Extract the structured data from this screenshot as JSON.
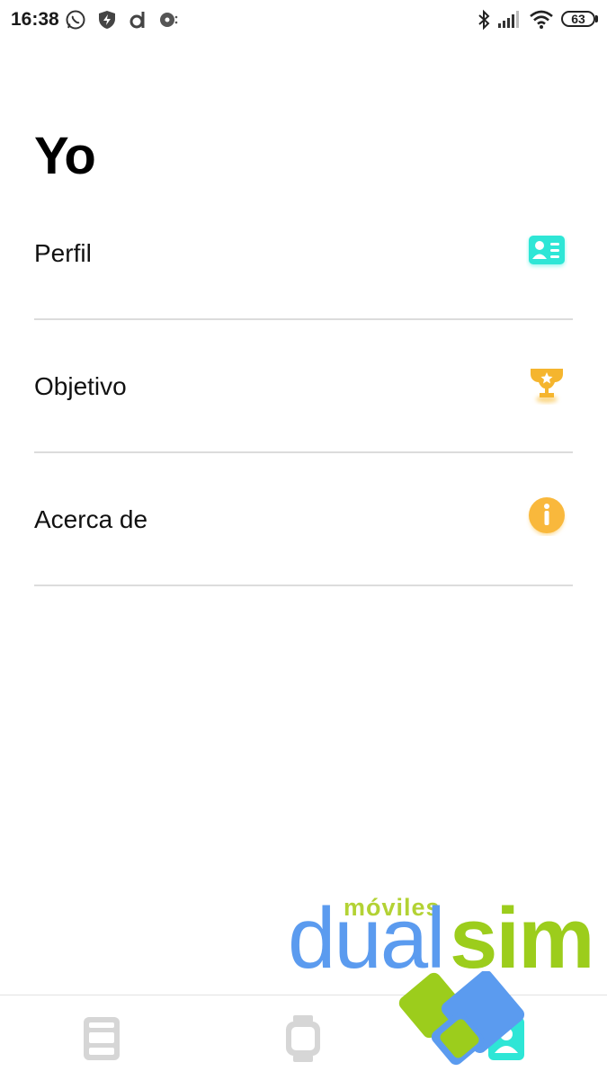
{
  "status_bar": {
    "time": "16:38",
    "icons": [
      "whatsapp-icon",
      "shield-bolt-icon",
      "d-app-icon",
      "media-icon",
      "bluetooth-icon",
      "signal-icon",
      "wifi-icon"
    ],
    "battery": "63"
  },
  "page": {
    "title": "Yo"
  },
  "menu": {
    "items": [
      {
        "label": "Perfil",
        "icon": "profile-card-icon",
        "color": "#2ee6d6"
      },
      {
        "label": "Objetivo",
        "icon": "trophy-icon",
        "color": "#f5b52e"
      },
      {
        "label": "Acerca de",
        "icon": "info-icon",
        "color": "#f9b83c"
      }
    ]
  },
  "bottom_nav": {
    "tabs": [
      {
        "icon": "dashboard-icon",
        "active": false
      },
      {
        "icon": "watch-icon",
        "active": false
      },
      {
        "icon": "profile-icon",
        "active": true
      }
    ],
    "active_color": "#2ee6d6",
    "inactive_color": "#d6d6d6"
  },
  "watermark": {
    "small": "móviles",
    "dual": "dual",
    "sim": "sim"
  }
}
